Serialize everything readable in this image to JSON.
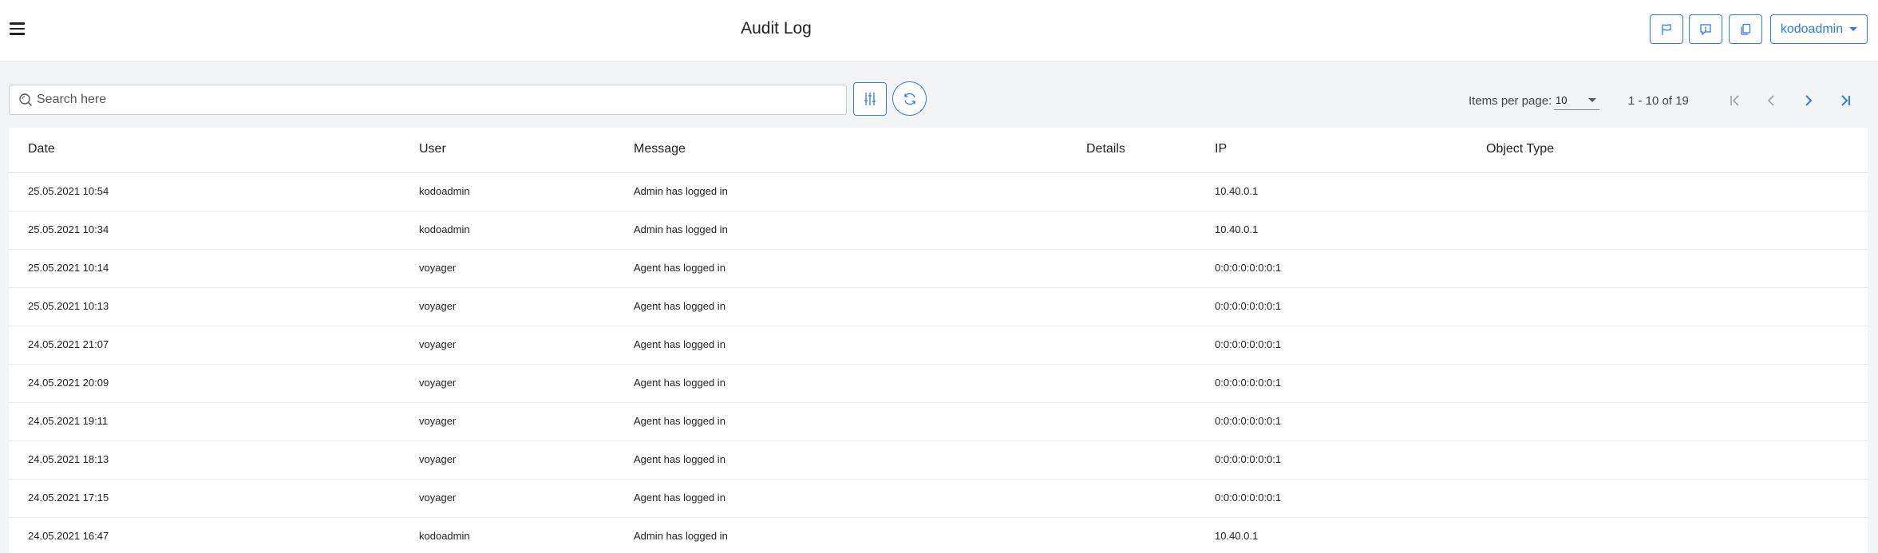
{
  "header": {
    "title": "Audit Log",
    "user_label": "kodoadmin",
    "menu_icon": "hamburger-icon",
    "buttons": [
      "flag-icon",
      "feedback-icon",
      "copy-icon"
    ]
  },
  "toolbar": {
    "search_placeholder": "Search here",
    "search_value": "",
    "filter_icon": "sliders-icon",
    "reset_icon": "refresh-icon"
  },
  "pagination": {
    "items_per_page_label": "Items per page:",
    "items_per_page_value": "10",
    "range_label": "1 - 10 of 19"
  },
  "table": {
    "headers": {
      "date": "Date",
      "user": "User",
      "message": "Message",
      "details": "Details",
      "ip": "IP",
      "object_type": "Object Type"
    },
    "rows": [
      {
        "date": "25.05.2021 10:54",
        "user": "kodoadmin",
        "message": "Admin has logged in",
        "details": "",
        "ip": "10.40.0.1",
        "object_type": ""
      },
      {
        "date": "25.05.2021 10:34",
        "user": "kodoadmin",
        "message": "Admin has logged in",
        "details": "",
        "ip": "10.40.0.1",
        "object_type": ""
      },
      {
        "date": "25.05.2021 10:14",
        "user": "voyager",
        "message": "Agent has logged in",
        "details": "",
        "ip": "0:0:0:0:0:0:0:1",
        "object_type": ""
      },
      {
        "date": "25.05.2021 10:13",
        "user": "voyager",
        "message": "Agent has logged in",
        "details": "",
        "ip": "0:0:0:0:0:0:0:1",
        "object_type": ""
      },
      {
        "date": "24.05.2021 21:07",
        "user": "voyager",
        "message": "Agent has logged in",
        "details": "",
        "ip": "0:0:0:0:0:0:0:1",
        "object_type": ""
      },
      {
        "date": "24.05.2021 20:09",
        "user": "voyager",
        "message": "Agent has logged in",
        "details": "",
        "ip": "0:0:0:0:0:0:0:1",
        "object_type": ""
      },
      {
        "date": "24.05.2021 19:11",
        "user": "voyager",
        "message": "Agent has logged in",
        "details": "",
        "ip": "0:0:0:0:0:0:0:1",
        "object_type": ""
      },
      {
        "date": "24.05.2021 18:13",
        "user": "voyager",
        "message": "Agent has logged in",
        "details": "",
        "ip": "0:0:0:0:0:0:0:1",
        "object_type": ""
      },
      {
        "date": "24.05.2021 17:15",
        "user": "voyager",
        "message": "Agent has logged in",
        "details": "",
        "ip": "0:0:0:0:0:0:0:1",
        "object_type": ""
      },
      {
        "date": "24.05.2021 16:47",
        "user": "kodoadmin",
        "message": "Admin has logged in",
        "details": "",
        "ip": "10.40.0.1",
        "object_type": ""
      }
    ]
  },
  "colors": {
    "accent": "#2d7be5",
    "background": "#f3f4f6"
  }
}
